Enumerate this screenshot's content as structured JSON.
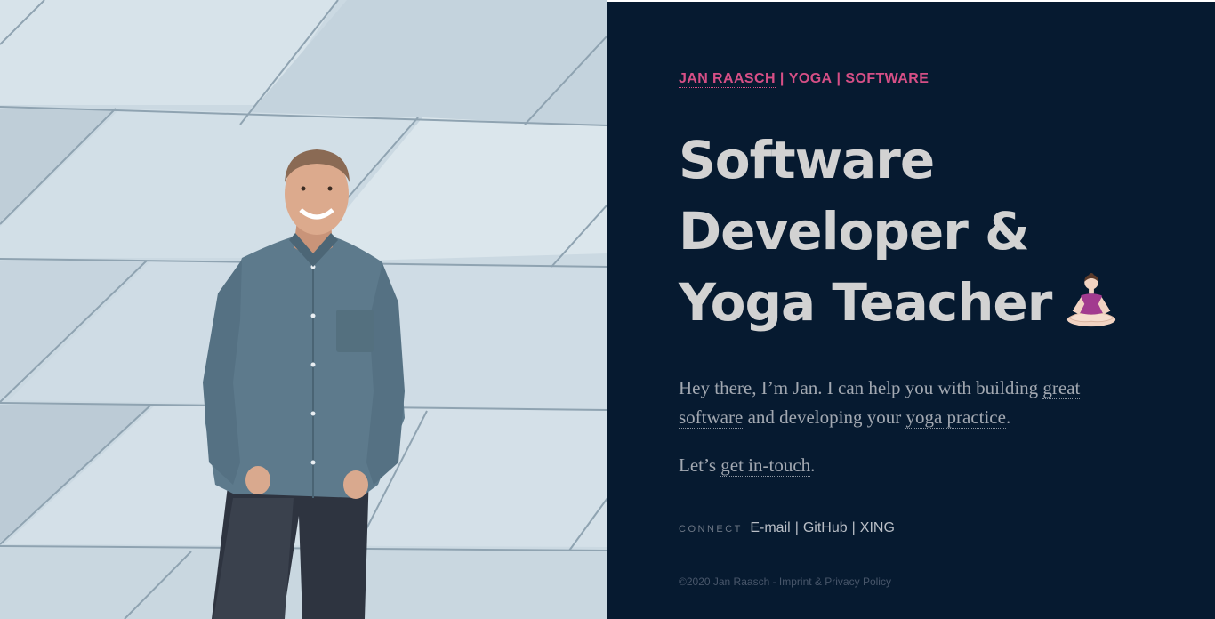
{
  "colors": {
    "panel_background": "#061a30",
    "accent_pink": "#d64f86",
    "headline_text": "#d2d2d2",
    "body_text": "#a2a8b1"
  },
  "photo": {
    "description_icon": "person-photo"
  },
  "nav": {
    "home_label": "JAN RAASCH",
    "separator": "|",
    "yoga_label": "YOGA",
    "software_label": "SOFTWARE"
  },
  "headline": {
    "line1": "Software",
    "line2": "Developer &",
    "line3": "Yoga Teacher",
    "emoji_icon": "person-in-lotus-position-icon"
  },
  "intro": {
    "part1": "Hey there, I’m Jan. I can help you with building ",
    "link_software": "great software",
    "part2": " and developing your ",
    "link_yoga": "yoga practice",
    "part3": "."
  },
  "cta": {
    "prefix": "Let’s ",
    "link": "get in-touch",
    "suffix": "."
  },
  "connect": {
    "label": "CONNECT",
    "email": "E-mail",
    "github": "GitHub",
    "xing": "XING",
    "separator": "|"
  },
  "footer": {
    "copyright": "©2020 Jan Raasch - ",
    "imprint": "Imprint",
    "amp": " & ",
    "privacy": "Privacy Policy"
  }
}
